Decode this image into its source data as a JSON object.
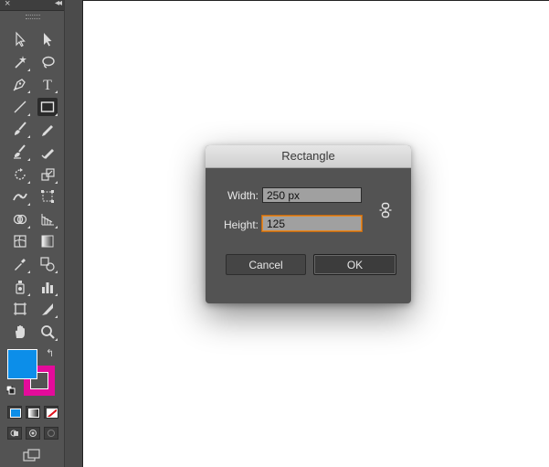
{
  "toolbar": {
    "close_glyph": "×",
    "collapse_glyph": "◂◂",
    "tools": [
      {
        "name": "selection-tool",
        "icon": "selection-arrow-icon",
        "active": false
      },
      {
        "name": "direct-selection-tool",
        "icon": "direct-selection-arrow-icon",
        "active": false
      },
      {
        "name": "magic-wand-tool",
        "icon": "magic-wand-icon",
        "active": false
      },
      {
        "name": "lasso-tool",
        "icon": "lasso-icon",
        "active": false
      },
      {
        "name": "pen-tool",
        "icon": "pen-icon",
        "active": false
      },
      {
        "name": "type-tool",
        "icon": "type-icon",
        "active": false
      },
      {
        "name": "line-segment-tool",
        "icon": "line-icon",
        "active": false
      },
      {
        "name": "rectangle-tool",
        "icon": "rectangle-icon",
        "active": true
      },
      {
        "name": "paintbrush-tool",
        "icon": "paintbrush-icon",
        "active": false
      },
      {
        "name": "pencil-tool",
        "icon": "pencil-icon",
        "active": false
      },
      {
        "name": "blob-brush-tool",
        "icon": "blob-brush-icon",
        "active": false
      },
      {
        "name": "eraser-tool",
        "icon": "eraser-icon",
        "active": false
      },
      {
        "name": "rotate-tool",
        "icon": "rotate-icon",
        "active": false
      },
      {
        "name": "scale-tool",
        "icon": "scale-icon",
        "active": false
      },
      {
        "name": "width-tool",
        "icon": "width-icon",
        "active": false
      },
      {
        "name": "free-transform-tool",
        "icon": "free-transform-icon",
        "active": false
      },
      {
        "name": "shape-builder-tool",
        "icon": "shape-builder-icon",
        "active": false
      },
      {
        "name": "perspective-grid-tool",
        "icon": "perspective-grid-icon",
        "active": false
      },
      {
        "name": "mesh-tool",
        "icon": "mesh-icon",
        "active": false
      },
      {
        "name": "gradient-tool",
        "icon": "gradient-icon",
        "active": false
      },
      {
        "name": "eyedropper-tool",
        "icon": "eyedropper-icon",
        "active": false
      },
      {
        "name": "blend-tool",
        "icon": "blend-icon",
        "active": false
      },
      {
        "name": "symbol-sprayer-tool",
        "icon": "symbol-sprayer-icon",
        "active": false
      },
      {
        "name": "column-graph-tool",
        "icon": "column-graph-icon",
        "active": false
      },
      {
        "name": "artboard-tool",
        "icon": "artboard-icon",
        "active": false
      },
      {
        "name": "slice-tool",
        "icon": "slice-icon",
        "active": false
      },
      {
        "name": "hand-tool",
        "icon": "hand-icon",
        "active": false
      },
      {
        "name": "zoom-tool",
        "icon": "zoom-icon",
        "active": false
      }
    ],
    "fill_color": "#0c8ee9",
    "stroke_color": "#e40b9b",
    "swap_glyph": "↰"
  },
  "dialog": {
    "title": "Rectangle",
    "width_label": "Width:",
    "width_value": "250 px",
    "height_label": "Height:",
    "height_value": "125",
    "cancel_label": "Cancel",
    "ok_label": "OK",
    "constrain_icon": "link-constrain-icon"
  },
  "colors": {
    "focus": "#e38a2a",
    "panel": "#535353"
  }
}
